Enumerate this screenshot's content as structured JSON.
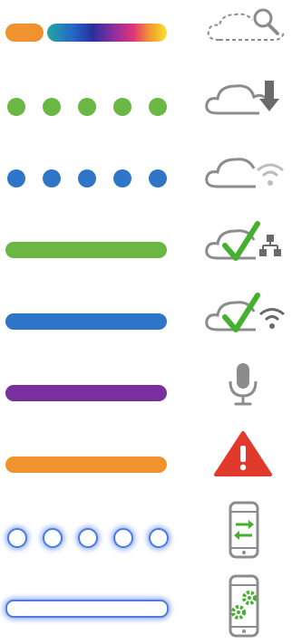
{
  "colors": {
    "orange": "#f0922e",
    "green": "#6ab744",
    "blue": "#2f76c9",
    "purple": "#7a2f9e",
    "glow_blue": "#4a7be0",
    "icon_gray": "#8c8c8c",
    "check_green": "#45b02e",
    "alert_red": "#e13a2d"
  },
  "rows": [
    {
      "indicator": "orange-pill-and-rainbow-bar",
      "icon": "cloud-search-icon"
    },
    {
      "indicator": "green-dots",
      "icon": "cloud-download-icon"
    },
    {
      "indicator": "blue-dots",
      "icon": "cloud-wifi-icon"
    },
    {
      "indicator": "green-bar",
      "icon": "cloud-check-network-icon"
    },
    {
      "indicator": "blue-bar",
      "icon": "cloud-check-wifi-icon"
    },
    {
      "indicator": "purple-bar",
      "icon": "microphone-icon"
    },
    {
      "indicator": "orange-bar",
      "icon": "warning-icon"
    },
    {
      "indicator": "glowing-rings",
      "icon": "phone-transfer-icon"
    },
    {
      "indicator": "glowing-outline-bar",
      "icon": "phone-settings-icon"
    }
  ]
}
